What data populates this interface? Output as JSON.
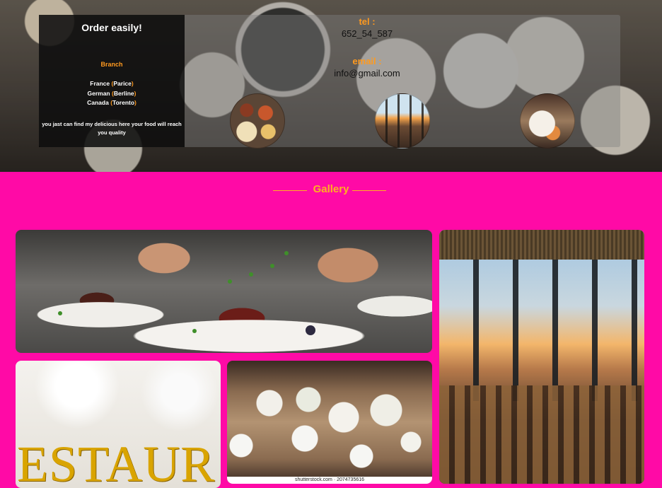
{
  "hero": {
    "order_title": "Order easily!",
    "branch_title": "Branch",
    "branches": [
      {
        "country": "France",
        "city": "Parice"
      },
      {
        "country": "German",
        "city": "Berline"
      },
      {
        "country": "Canada",
        "city": "Torento"
      }
    ],
    "tagline": "you jast can find my delicious here your food will reach you quality",
    "tel_label": "tel :",
    "tel_value": "652_54_587",
    "email_label": "email :",
    "email_value": "info@gmail.com",
    "thumbnails": [
      "food-platter",
      "restaurant-sunset-view",
      "plated-dish"
    ]
  },
  "gallery": {
    "heading": "Gallery",
    "photos": [
      "chef-plating",
      "restaurant-city-view",
      "restaurant-sign",
      "shared-table"
    ],
    "sign_text": "ESTAUR",
    "watermark": "shutterstock.com · 2074735616"
  },
  "colors": {
    "accent_orange": "#ff9a1f",
    "gallery_bg": "#ff0aa6",
    "heading_gold": "#ffb020"
  }
}
